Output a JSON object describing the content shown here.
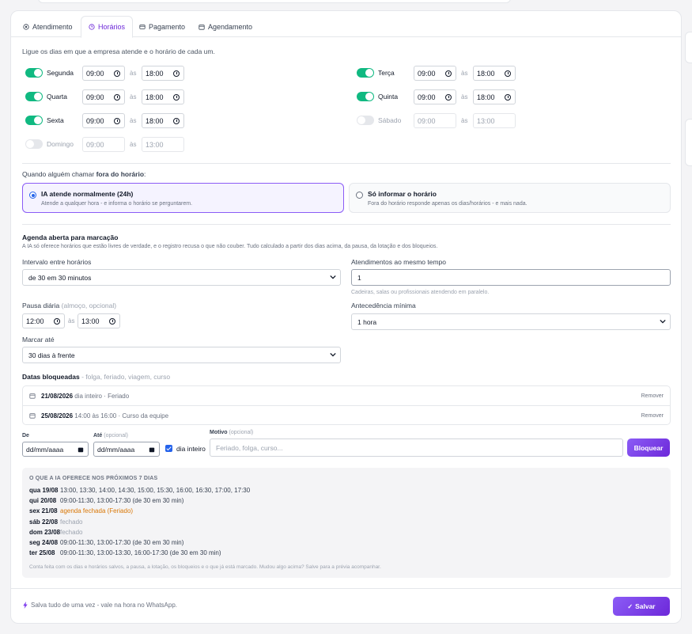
{
  "tabs": [
    {
      "label": "Atendimento",
      "icon": "target-icon"
    },
    {
      "label": "Horários",
      "icon": "clock-icon",
      "active": true
    },
    {
      "label": "Pagamento",
      "icon": "card-icon"
    },
    {
      "label": "Agendamento",
      "icon": "calendar-icon"
    }
  ],
  "intro": "Ligue os dias em que a empresa atende e o horário de cada um.",
  "separator": "às",
  "days": [
    {
      "name": "Segunda",
      "on": true,
      "start": "09:00",
      "end": "18:00"
    },
    {
      "name": "Terça",
      "on": true,
      "start": "09:00",
      "end": "18:00"
    },
    {
      "name": "Quarta",
      "on": true,
      "start": "09:00",
      "end": "18:00"
    },
    {
      "name": "Quinta",
      "on": true,
      "start": "09:00",
      "end": "18:00"
    },
    {
      "name": "Sexta",
      "on": true,
      "start": "09:00",
      "end": "18:00"
    },
    {
      "name": "Sábado",
      "on": false,
      "start": "09:00",
      "end": "13:00"
    },
    {
      "name": "Domingo",
      "on": false,
      "start": "09:00",
      "end": "13:00"
    }
  ],
  "outside": {
    "label_pre": "Quando alguém chamar ",
    "label_bold": "fora do horário",
    "label_post": ":",
    "option_ai_title": "IA atende normalmente (24h)",
    "option_ai_desc": "Atende a qualquer hora - e informa o horário se perguntarem.",
    "option_info_title": "Só informar o horário",
    "option_info_desc": "Fora do horário responde apenas os dias/horários - e mais nada."
  },
  "agenda": {
    "title": "Agenda aberta para marcação",
    "desc": "A IA só oferece horários que estão livres de verdade, e o registro recusa o que não couber. Tudo calculado a partir dos dias acima, da pausa, da lotação e dos bloqueios.",
    "interval_label": "Intervalo entre horários",
    "interval_value": "de 30 em 30 minutos",
    "simultaneous_label": "Atendimentos ao mesmo tempo",
    "simultaneous_value": "1",
    "simultaneous_hint": "Cadeiras, salas ou profissionais atendendo em paralelo.",
    "pause_label": "Pausa diária",
    "pause_optional": "(almoço, opcional)",
    "pause_start": "12:00",
    "pause_end": "13:00",
    "advance_label": "Antecedência mínima",
    "advance_value": "1 hora",
    "until_label": "Marcar até",
    "until_value": "30 dias à frente"
  },
  "blocked": {
    "title": "Datas bloqueadas",
    "subtitle": " - folga, feriado, viagem, curso",
    "items": [
      {
        "date": "21/08/2026",
        "detail": "dia inteiro",
        "reason": " · Feriado",
        "remove": "Remover"
      },
      {
        "date": "25/08/2026",
        "detail": "14:00 às 16:00",
        "reason": " · Curso da equipe",
        "remove": "Remover"
      }
    ],
    "from_label": "De",
    "to_label": "Até",
    "to_optional": "(opcional)",
    "from_placeholder": "dd/mm/aaaa",
    "to_placeholder": "dd/mm/aaaa",
    "allday_label": "dia inteiro",
    "reason_label": "Motivo",
    "reason_optional": "(opcional)",
    "reason_placeholder": "Feriado, folga, curso...",
    "block_button": "Bloquear"
  },
  "preview": {
    "title": "O QUE A IA OFERECE NOS PRÓXIMOS 7 DIAS",
    "rows": [
      {
        "day": "qua 19/08",
        "text": "13:00, 13:30, 14:00, 14:30, 15:00, 15:30, 16:00, 16:30, 17:00, 17:30",
        "kind": "slots"
      },
      {
        "day": "qui 20/08",
        "text": "09:00-11:30, 13:00-17:30 (de 30 em 30 min)",
        "kind": "slots"
      },
      {
        "day": "sex 21/08",
        "text": "agenda fechada (Feriado)",
        "kind": "warn"
      },
      {
        "day": "sáb 22/08",
        "text": "fechado",
        "kind": "closed"
      },
      {
        "day": "dom 23/08",
        "text": "fechado",
        "kind": "closed"
      },
      {
        "day": "seg 24/08",
        "text": "09:00-11:30, 13:00-17:30 (de 30 em 30 min)",
        "kind": "slots"
      },
      {
        "day": "ter 25/08",
        "text": "09:00-11:30, 13:00-13:30, 16:00-17:30 (de 30 em 30 min)",
        "kind": "slots"
      }
    ],
    "note": "Conta feita com os dias e horários salvos, a pausa, a lotação, os bloqueios e o que já está marcado. Mudou algo acima? Salve para a prévia acompanhar."
  },
  "footer": {
    "hint": "Salva tudo de uma vez - vale na hora no WhatsApp.",
    "save": "Salvar"
  },
  "colors": {
    "accent": "#7c3aed",
    "toggle_on": "#10b981",
    "warn": "#d97706"
  }
}
